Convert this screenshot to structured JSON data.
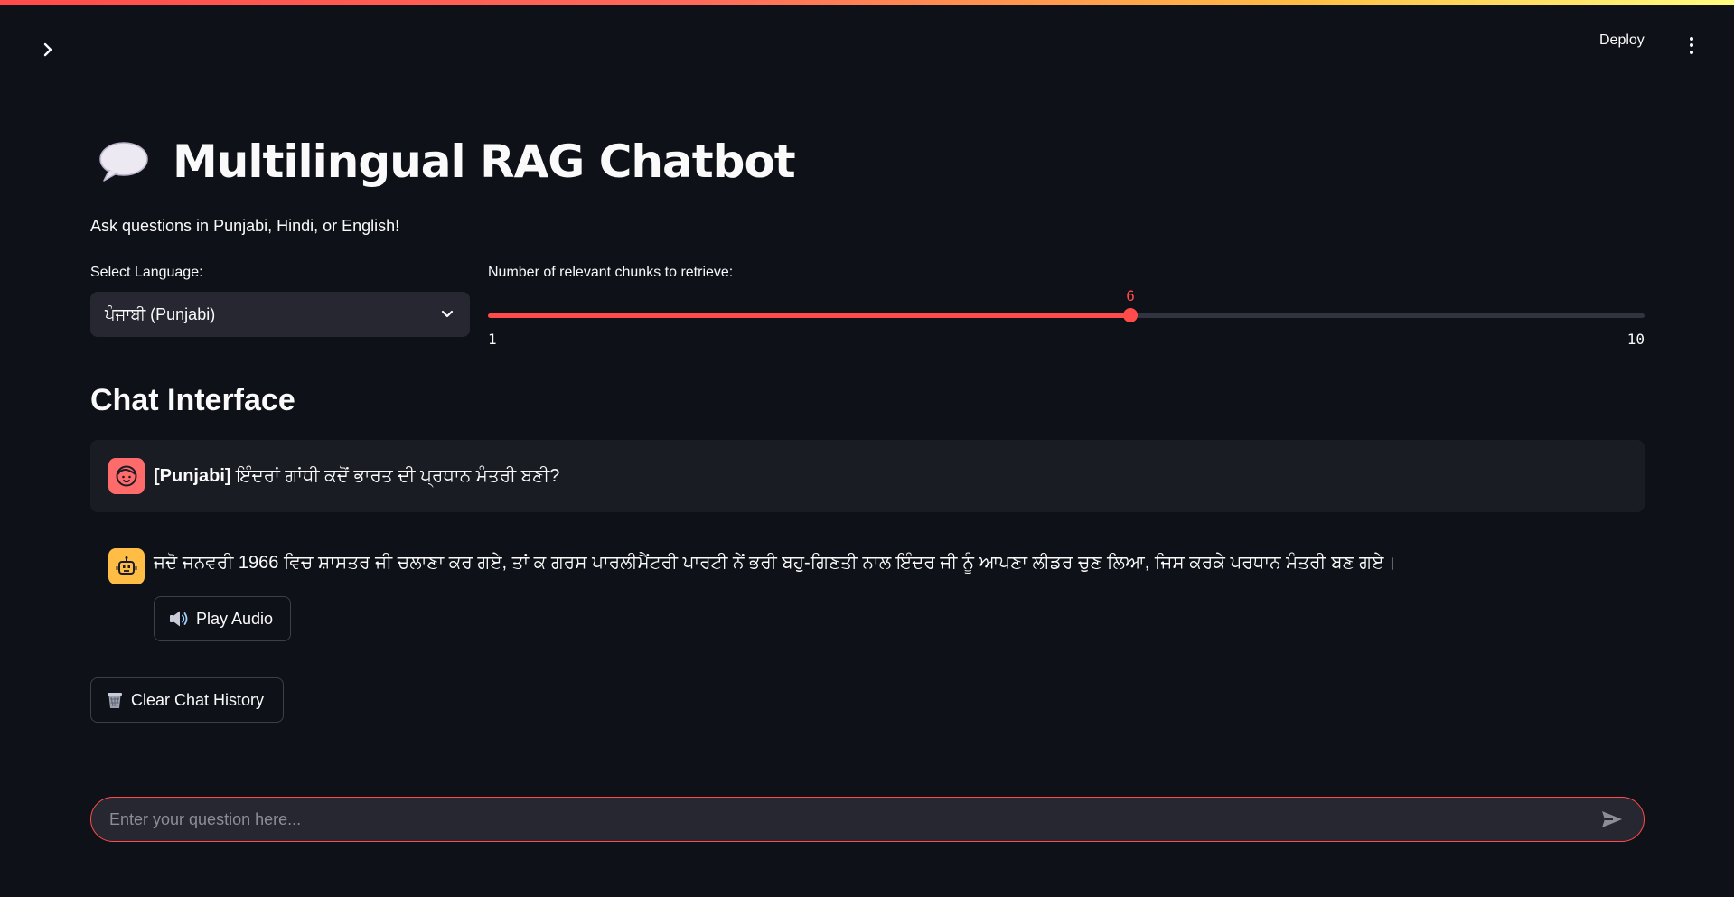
{
  "header": {
    "deploy_label": "Deploy",
    "sidebar_toggle_icon": "chevron-right-icon",
    "menu_icon": "vertical-ellipsis-icon"
  },
  "main": {
    "title": "Multilingual RAG Chatbot",
    "title_icon": "speech-bubble-icon",
    "subtitle": "Ask questions in Punjabi, Hindi, or English!"
  },
  "language_select": {
    "label": "Select Language:",
    "value": "ਪੰਜਾਬੀ (Punjabi)"
  },
  "chunks_slider": {
    "label": "Number of relevant chunks to retrieve:",
    "value": 6,
    "min": 1,
    "max": 10,
    "value_label": "6",
    "min_label": "1",
    "max_label": "10",
    "color": "#ff4b4b"
  },
  "chat": {
    "section_title": "Chat Interface",
    "messages": [
      {
        "role": "user",
        "avatar_icon": "user-face-icon",
        "lang_tag": "[Punjabi]",
        "text": "ਇੰਦਰਾਂ ਗਾਂਧੀ ਕਦੋਂ ਭਾਰਤ ਦੀ ਪ੍ਰਧਾਨ ਮੰਤਰੀ ਬਣੀ?"
      },
      {
        "role": "assistant",
        "avatar_icon": "robot-icon",
        "text": "ਜਦੋ ਜਨਵਰੀ 1966 ਵਿਚ ਸ਼ਾਸਤਰ ਜੀ ਚਲਾਣਾ ਕਰ ਗਏ, ਤਾਂ ਕ ਗਰਸ ਪਾਰਲੀਮੈਂਟਰੀ ਪਾਰਟੀ ਨੇਂ ਭਰੀ ਬਹੁ-ਗਿਣਤੀ ਨਾਲ ਇੰਦਰ ਜੀ ਨੂੰ ਆਪਣਾ ਲੀਡਰ ਚੁਣ ਲਿਆ, ਜਿਸ ਕਰਕੇ ਪਰਧਾਨ ਮੰਤਰੀ ਬਣ ਗਏ।",
        "play_audio_label": "Play Audio",
        "play_audio_icon": "speaker-icon"
      }
    ],
    "clear_history_label": "Clear Chat History",
    "clear_history_icon": "wastebasket-icon",
    "input_placeholder": "Enter your question here...",
    "input_value": "",
    "send_icon": "send-icon"
  },
  "colors": {
    "background": "#0e1117",
    "accent": "#ff4b4b",
    "user_avatar": "#ff6b6b",
    "bot_avatar": "#ffbd45"
  }
}
